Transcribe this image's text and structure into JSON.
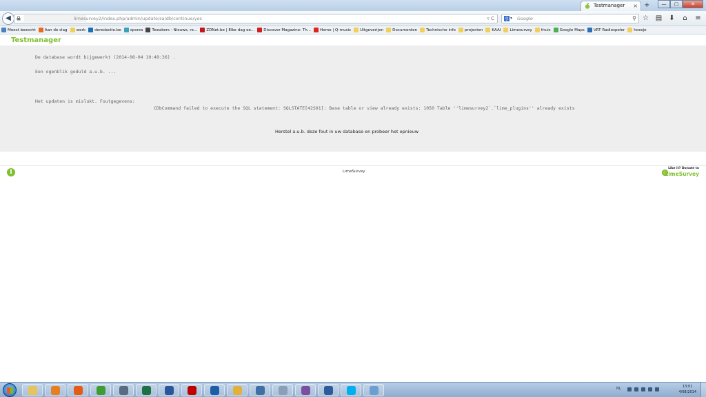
{
  "browser": {
    "tab_title": "Testmanager",
    "tab_close": "×",
    "new_tab": "+",
    "window_buttons": {
      "minimize": "—",
      "maximize": "▢",
      "close": "✕"
    },
    "back": "◀",
    "url": "limesurvey2/index.php/admin/update/sa/db/continue/yes",
    "url_controls": "▿ C",
    "search_placeholder": "Google",
    "search_engine": "g",
    "search_engine_arrow": "▾",
    "search_icon": "⚲",
    "nav_icons": [
      "☆",
      "▤",
      "⬇",
      "⌂",
      "≡"
    ],
    "bookmarks": [
      {
        "label": "Meest bezocht",
        "color": "#4a7fc1"
      },
      {
        "label": "Aan de slag",
        "color": "#e66a1f"
      },
      {
        "label": "werk",
        "color": "#f2cf5b"
      },
      {
        "label": "deredactie.be",
        "color": "#1b6fb8"
      },
      {
        "label": "sporza",
        "color": "#3aa3b8"
      },
      {
        "label": "Tweakers - Nieuws, re...",
        "color": "#444444"
      },
      {
        "label": "ZDNet.be | Elke dag ee...",
        "color": "#c4161c"
      },
      {
        "label": "Discover Magazine: Th...",
        "color": "#d11f1f"
      },
      {
        "label": "Home | Q-music",
        "color": "#e2231a"
      },
      {
        "label": "Uitgeverijen",
        "color": "#f2cf5b"
      },
      {
        "label": "Documenten",
        "color": "#f2cf5b"
      },
      {
        "label": "Technische info",
        "color": "#f2cf5b"
      },
      {
        "label": "projecten",
        "color": "#f2cf5b"
      },
      {
        "label": "KAAI",
        "color": "#f2cf5b"
      },
      {
        "label": "Limesurvey",
        "color": "#f2cf5b"
      },
      {
        "label": "thuis",
        "color": "#f2cf5b"
      },
      {
        "label": "Google Maps",
        "color": "#4caf50"
      },
      {
        "label": "VRT Radiospeler",
        "color": "#2c6fb7"
      },
      {
        "label": "hoesje",
        "color": "#f2cf5b"
      }
    ]
  },
  "page": {
    "app_title": "Testmanager",
    "line_updating": "De database wordt bijgewerkt (2014-08-04 10:49:36) .",
    "line_wait": "Een ogenblik geduld a.u.b. ...",
    "line_failed": "Het updaten is mislukt. Foutgegevens:",
    "line_error": "CDbCommand failed to execute the SQL statement: SQLSTATE[42S01]: Base table or view already exists: 1050 Table ''limesurvey2`.`lime_plugins'' already exists",
    "line_fix": "Herstel a.u.b. deze fout in uw database en probeer het opnieuw",
    "info_icon": "i",
    "footer_center": "LimeSurvey",
    "donate_top": "Like it? Donate to",
    "donate_brand": "LimeSurvey"
  },
  "taskbar": {
    "items": [
      {
        "name": "explorer",
        "color": "#e6c35c"
      },
      {
        "name": "media-player",
        "color": "#e67e22"
      },
      {
        "name": "firefox",
        "color": "#e55b13"
      },
      {
        "name": "chrome",
        "color": "#3f9c35"
      },
      {
        "name": "notepad",
        "color": "#5a6c84"
      },
      {
        "name": "excel",
        "color": "#1e7145"
      },
      {
        "name": "word",
        "color": "#2b579a"
      },
      {
        "name": "filezilla",
        "color": "#bf0000"
      },
      {
        "name": "virtualbox",
        "color": "#1d5fa6"
      },
      {
        "name": "folder",
        "color": "#e0b13b"
      },
      {
        "name": "network",
        "color": "#3f6fa3"
      },
      {
        "name": "calculator",
        "color": "#8aa0b8"
      },
      {
        "name": "media",
        "color": "#7b4fa0"
      },
      {
        "name": "thunderbird",
        "color": "#2e5c9a"
      },
      {
        "name": "skype",
        "color": "#00aff0"
      },
      {
        "name": "app",
        "color": "#6d9ed1"
      }
    ],
    "lang": "NL",
    "time": "13:01",
    "date": "4/08/2014"
  }
}
